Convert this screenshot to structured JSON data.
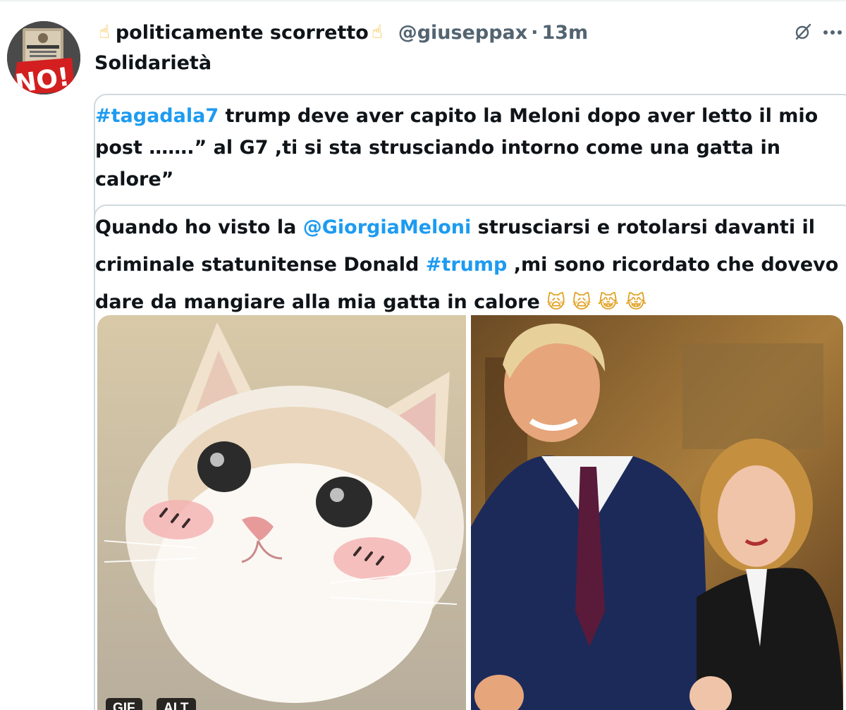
{
  "tweet": {
    "display_name": "politicamente scorretto",
    "name_emoji_left": "☝",
    "name_emoji_right": "☝",
    "handle": "@giuseppax",
    "separator": "·",
    "time": "13m",
    "text": "Solidarietà",
    "icons": {
      "avatar": "avatar-costituzione-no",
      "grok": "grok-icon",
      "more": "more-options-icon"
    }
  },
  "quote_outer": {
    "hashtag": "#tagadala7",
    "text": " trump deve aver capito la Meloni dopo aver letto il mio post …….” al G7 ,ti si sta strusciando intorno come una gatta in calore”"
  },
  "quote_inner": {
    "part1": "Quando ho visto la ",
    "mention": "@GiorgiaMeloni",
    "part2": "  strusciarsi e rotolarsi davanti il criminale statunitense Donald ",
    "hashtag": "#trump",
    "part3": " ,mi sono ricordato che dovevo dare da mangiare alla mia gatta in calore ",
    "emojis": "🙀 🙀 😹 😹"
  },
  "media": {
    "left_badges": [
      "GIF",
      "ALT"
    ]
  },
  "colors": {
    "link": "#1d9bf0",
    "secondary_text": "#536471",
    "border": "#cfd9de"
  }
}
